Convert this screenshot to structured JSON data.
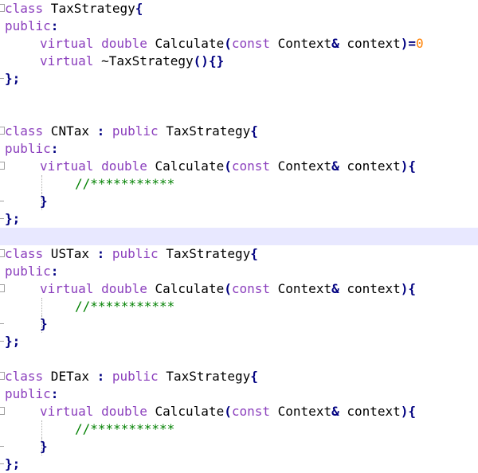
{
  "editor": {
    "colors": {
      "keyword": "#8b3fbd",
      "identifier": "#000000",
      "punctuation": "#000080",
      "number": "#ff8000",
      "comment": "#008000",
      "current_line": "#e8e8ff"
    },
    "lines": [
      {
        "fold": "start",
        "indent": 0,
        "tokens": [
          {
            "k": "kw",
            "t": "class"
          },
          {
            "k": "id",
            "t": " TaxStrategy"
          },
          {
            "k": "punct",
            "t": "{"
          }
        ]
      },
      {
        "fold": "none",
        "indent": 0,
        "tokens": [
          {
            "k": "kw",
            "t": "public"
          },
          {
            "k": "punct",
            "t": ":"
          }
        ]
      },
      {
        "fold": "none",
        "indent": 1,
        "tokens": [
          {
            "k": "kw",
            "t": "virtual"
          },
          {
            "k": "id",
            "t": " "
          },
          {
            "k": "type",
            "t": "double"
          },
          {
            "k": "id",
            "t": " Calculate"
          },
          {
            "k": "punct",
            "t": "("
          },
          {
            "k": "kw",
            "t": "const"
          },
          {
            "k": "id",
            "t": " Context"
          },
          {
            "k": "punct",
            "t": "&"
          },
          {
            "k": "id",
            "t": " context"
          },
          {
            "k": "punct",
            "t": ")="
          },
          {
            "k": "num",
            "t": "0"
          }
        ]
      },
      {
        "fold": "none",
        "indent": 1,
        "tokens": [
          {
            "k": "kw",
            "t": "virtual"
          },
          {
            "k": "id",
            "t": " ~TaxStrategy"
          },
          {
            "k": "punct",
            "t": "(){}"
          }
        ]
      },
      {
        "fold": "end",
        "indent": 0,
        "tokens": [
          {
            "k": "punct",
            "t": "};"
          }
        ]
      },
      {
        "fold": "none",
        "indent": 0,
        "tokens": []
      },
      {
        "fold": "none",
        "indent": 0,
        "tokens": []
      },
      {
        "fold": "start",
        "indent": 0,
        "tokens": [
          {
            "k": "kw",
            "t": "class"
          },
          {
            "k": "id",
            "t": " CNTax "
          },
          {
            "k": "punct",
            "t": ":"
          },
          {
            "k": "id",
            "t": " "
          },
          {
            "k": "kw",
            "t": "public"
          },
          {
            "k": "id",
            "t": " TaxStrategy"
          },
          {
            "k": "punct",
            "t": "{"
          }
        ]
      },
      {
        "fold": "none",
        "indent": 0,
        "tokens": [
          {
            "k": "kw",
            "t": "public"
          },
          {
            "k": "punct",
            "t": ":"
          }
        ]
      },
      {
        "fold": "start",
        "indent": 1,
        "tokens": [
          {
            "k": "kw",
            "t": "virtual"
          },
          {
            "k": "id",
            "t": " "
          },
          {
            "k": "type",
            "t": "double"
          },
          {
            "k": "id",
            "t": " Calculate"
          },
          {
            "k": "punct",
            "t": "("
          },
          {
            "k": "kw",
            "t": "const"
          },
          {
            "k": "id",
            "t": " Context"
          },
          {
            "k": "punct",
            "t": "&"
          },
          {
            "k": "id",
            "t": " context"
          },
          {
            "k": "punct",
            "t": "){"
          }
        ]
      },
      {
        "fold": "none",
        "indent": 2,
        "guide": true,
        "tokens": [
          {
            "k": "comment",
            "t": "//***********"
          }
        ]
      },
      {
        "fold": "end",
        "indent": 1,
        "guide": true,
        "tokens": [
          {
            "k": "punct",
            "t": "}"
          }
        ]
      },
      {
        "fold": "end",
        "indent": 0,
        "tokens": [
          {
            "k": "punct",
            "t": "};"
          }
        ]
      },
      {
        "fold": "none",
        "indent": 0,
        "highlight": true,
        "tokens": []
      },
      {
        "fold": "start",
        "indent": 0,
        "tokens": [
          {
            "k": "kw",
            "t": "class"
          },
          {
            "k": "id",
            "t": " USTax "
          },
          {
            "k": "punct",
            "t": ":"
          },
          {
            "k": "id",
            "t": " "
          },
          {
            "k": "kw",
            "t": "public"
          },
          {
            "k": "id",
            "t": " TaxStrategy"
          },
          {
            "k": "punct",
            "t": "{"
          }
        ]
      },
      {
        "fold": "none",
        "indent": 0,
        "tokens": [
          {
            "k": "kw",
            "t": "public"
          },
          {
            "k": "punct",
            "t": ":"
          }
        ]
      },
      {
        "fold": "start",
        "indent": 1,
        "tokens": [
          {
            "k": "kw",
            "t": "virtual"
          },
          {
            "k": "id",
            "t": " "
          },
          {
            "k": "type",
            "t": "double"
          },
          {
            "k": "id",
            "t": " Calculate"
          },
          {
            "k": "punct",
            "t": "("
          },
          {
            "k": "kw",
            "t": "const"
          },
          {
            "k": "id",
            "t": " Context"
          },
          {
            "k": "punct",
            "t": "&"
          },
          {
            "k": "id",
            "t": " context"
          },
          {
            "k": "punct",
            "t": "){"
          }
        ]
      },
      {
        "fold": "none",
        "indent": 2,
        "guide": true,
        "tokens": [
          {
            "k": "comment",
            "t": "//***********"
          }
        ]
      },
      {
        "fold": "end",
        "indent": 1,
        "guide": true,
        "tokens": [
          {
            "k": "punct",
            "t": "}"
          }
        ]
      },
      {
        "fold": "end",
        "indent": 0,
        "tokens": [
          {
            "k": "punct",
            "t": "};"
          }
        ]
      },
      {
        "fold": "none",
        "indent": 0,
        "tokens": []
      },
      {
        "fold": "start",
        "indent": 0,
        "tokens": [
          {
            "k": "kw",
            "t": "class"
          },
          {
            "k": "id",
            "t": " DETax "
          },
          {
            "k": "punct",
            "t": ":"
          },
          {
            "k": "id",
            "t": " "
          },
          {
            "k": "kw",
            "t": "public"
          },
          {
            "k": "id",
            "t": " TaxStrategy"
          },
          {
            "k": "punct",
            "t": "{"
          }
        ]
      },
      {
        "fold": "none",
        "indent": 0,
        "tokens": [
          {
            "k": "kw",
            "t": "public"
          },
          {
            "k": "punct",
            "t": ":"
          }
        ]
      },
      {
        "fold": "start",
        "indent": 1,
        "tokens": [
          {
            "k": "kw",
            "t": "virtual"
          },
          {
            "k": "id",
            "t": " "
          },
          {
            "k": "type",
            "t": "double"
          },
          {
            "k": "id",
            "t": " Calculate"
          },
          {
            "k": "punct",
            "t": "("
          },
          {
            "k": "kw",
            "t": "const"
          },
          {
            "k": "id",
            "t": " Context"
          },
          {
            "k": "punct",
            "t": "&"
          },
          {
            "k": "id",
            "t": " context"
          },
          {
            "k": "punct",
            "t": "){"
          }
        ]
      },
      {
        "fold": "none",
        "indent": 2,
        "guide": true,
        "tokens": [
          {
            "k": "comment",
            "t": "//***********"
          }
        ]
      },
      {
        "fold": "end",
        "indent": 1,
        "guide": true,
        "tokens": [
          {
            "k": "punct",
            "t": "}"
          }
        ]
      },
      {
        "fold": "end",
        "indent": 0,
        "tokens": [
          {
            "k": "punct",
            "t": "};"
          }
        ]
      }
    ]
  }
}
